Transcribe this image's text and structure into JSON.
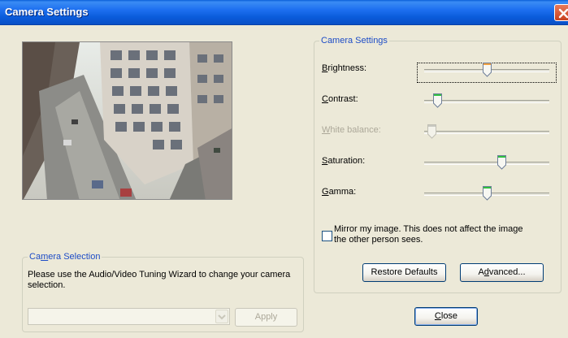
{
  "window": {
    "title": "Camera Settings"
  },
  "camera_settings": {
    "group_label": "Camera Settings",
    "sliders": [
      {
        "key": "B",
        "rest": "rightness:",
        "value": 0.5,
        "enabled": true,
        "thumb_color": "#f0a040"
      },
      {
        "key": "C",
        "rest": "ontrast:",
        "value": 0.08,
        "enabled": true,
        "thumb_color": "#30c040"
      },
      {
        "key": "W",
        "rest": "hite balance:",
        "value": 0.03,
        "enabled": false,
        "thumb_color": "#c8c8c0"
      },
      {
        "key": "S",
        "rest": "aturation:",
        "value": 0.63,
        "enabled": true,
        "thumb_color": "#30c040"
      },
      {
        "key": "G",
        "rest": "amma:",
        "value": 0.5,
        "enabled": true,
        "thumb_color": "#30c040"
      }
    ],
    "mirror_line1": "Mirror my image.  This does not affect the image",
    "mirror_line2": "the other person sees.",
    "mirror_checked": false,
    "restore_defaults": "Restore Defaults",
    "advanced_prefix": "A",
    "advanced_key": "d",
    "advanced_rest": "vanced..."
  },
  "camera_selection": {
    "group_label_prefix": "Ca",
    "group_label_key": "m",
    "group_label_rest": "era Selection",
    "instruction": "Please use the Audio/Video Tuning Wizard to change your camera selection.",
    "camera_value": "",
    "apply": "Apply"
  },
  "close_key": "C",
  "close_rest": "lose",
  "colors": {
    "title_bar": "#0a5cdb",
    "group_label": "#1d4cc6",
    "dialog_bg": "#ece9d8"
  }
}
